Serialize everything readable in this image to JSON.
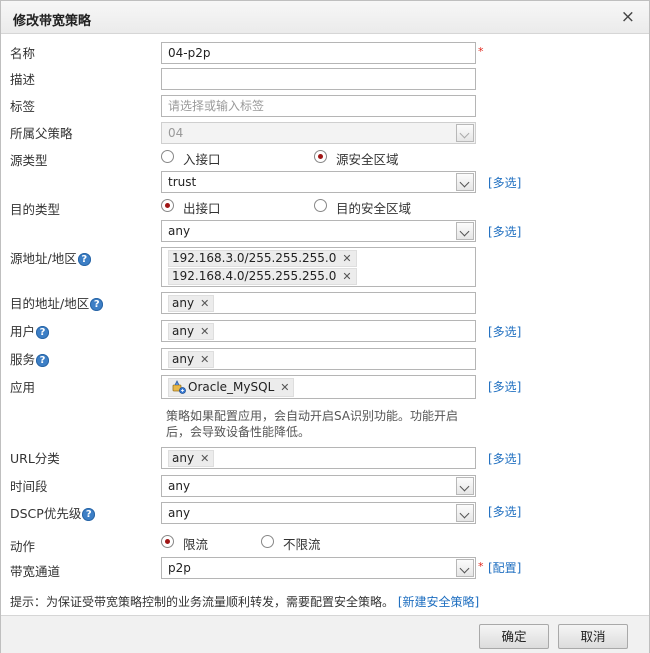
{
  "dialog": {
    "title": "修改带宽策略",
    "close": "×"
  },
  "fields": {
    "name": {
      "label": "名称",
      "value": "04-p2p",
      "required": "*"
    },
    "desc": {
      "label": "描述",
      "value": ""
    },
    "tag": {
      "label": "标签",
      "placeholder": "请选择或输入标签"
    },
    "parent": {
      "label": "所属父策略",
      "value": "04"
    },
    "src_type": {
      "label": "源类型",
      "options": [
        "入接口",
        "源安全区域"
      ],
      "selected": "源安全区域",
      "value": "trust",
      "multi": "[多选]"
    },
    "dst_type": {
      "label": "目的类型",
      "options": [
        "出接口",
        "目的安全区域"
      ],
      "selected": "出接口",
      "value": "any",
      "multi": "[多选]"
    },
    "src_addr": {
      "label": "源地址/地区",
      "help": "?",
      "tags": [
        "192.168.3.0/255.255.255.0",
        "192.168.4.0/255.255.255.0"
      ]
    },
    "dst_addr": {
      "label": "目的地址/地区",
      "help": "?",
      "tags": [
        "any"
      ]
    },
    "user": {
      "label": "用户",
      "help": "?",
      "tags": [
        "any"
      ],
      "multi": "[多选]"
    },
    "service": {
      "label": "服务",
      "help": "?",
      "tags": [
        "any"
      ]
    },
    "app": {
      "label": "应用",
      "tags": [
        "Oracle_MySQL"
      ],
      "multi": "[多选]",
      "icon": "app-plug-icon",
      "note": "策略如果配置应用，会自动开启SA识别功能。功能开启后，会导致设备性能降低。"
    },
    "url": {
      "label": "URL分类",
      "tags": [
        "any"
      ],
      "multi": "[多选]"
    },
    "time": {
      "label": "时间段",
      "value": "any"
    },
    "dscp": {
      "label": "DSCP优先级",
      "help": "?",
      "value": "any",
      "multi": "[多选]"
    },
    "action": {
      "label": "动作",
      "options": [
        "限流",
        "不限流"
      ],
      "selected": "限流"
    },
    "channel": {
      "label": "带宽通道",
      "value": "p2p",
      "required": "*",
      "config": "[配置]"
    }
  },
  "hint": {
    "text": "提示：为保证受带宽策略控制的业务流量顺利转发，需要配置安全策略。",
    "link": "[新建安全策略]"
  },
  "buttons": {
    "ok": "确定",
    "cancel": "取消"
  },
  "colors": {
    "link": "#1f6fc0",
    "required": "#e0261b",
    "radio_dot": "#a01616",
    "help_icon": "#3d7fc6"
  }
}
